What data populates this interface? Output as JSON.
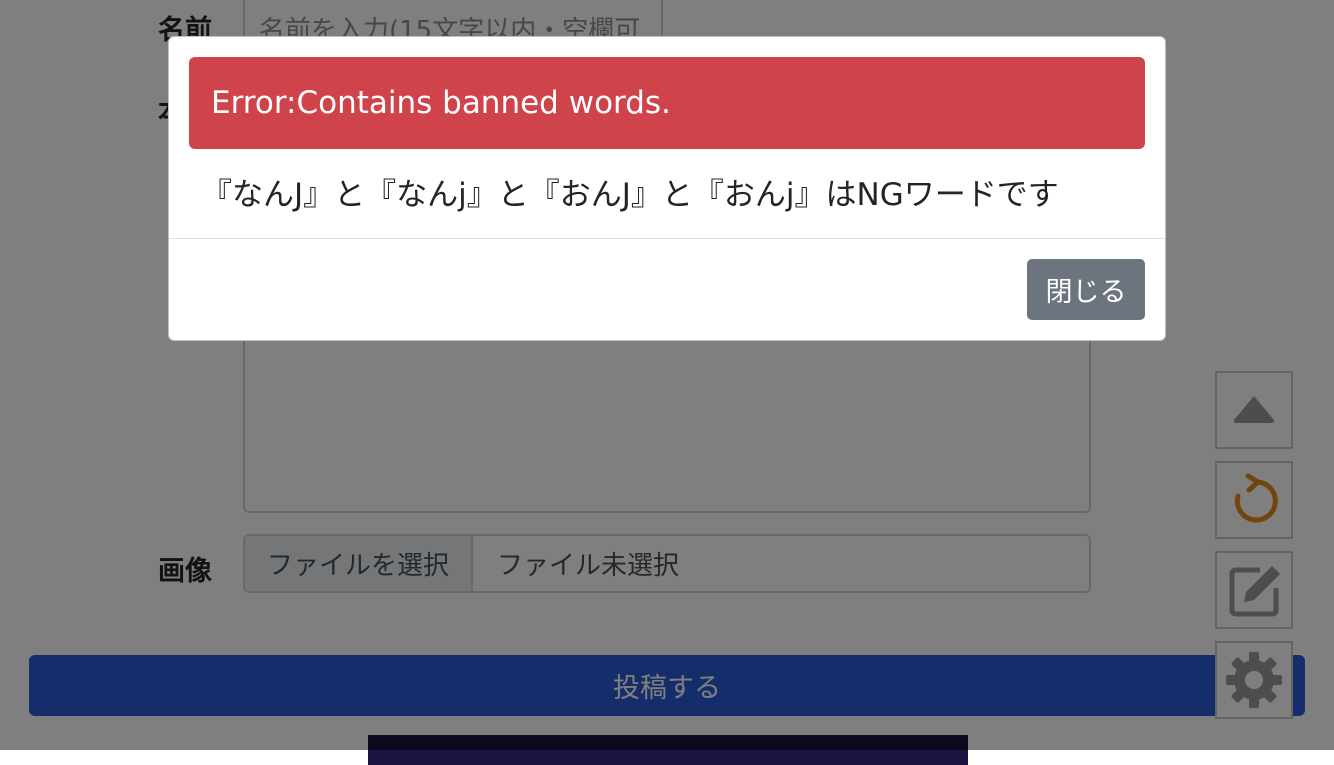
{
  "form": {
    "name_label": "名前",
    "name_placeholder": "名前を入力(15文字以内・空欄可",
    "body_label_partial": "本",
    "image_label": "画像",
    "file_button_label": "ファイルを選択",
    "file_status": "ファイル未選択",
    "submit_label": "投稿する"
  },
  "side_buttons": [
    {
      "icon": "triangle-up-icon"
    },
    {
      "icon": "refresh-icon",
      "color": "#e08a1e"
    },
    {
      "icon": "edit-icon"
    },
    {
      "icon": "gear-icon"
    }
  ],
  "modal": {
    "alert_text": "Error:Contains banned words.",
    "message": "『なんJ』と『なんj』と『おんJ』と『おんj』はNGワードです",
    "close_label": "閉じる"
  },
  "colors": {
    "alert": "#cf434a",
    "submit": "#2a5bd7",
    "close": "#6c757d"
  }
}
